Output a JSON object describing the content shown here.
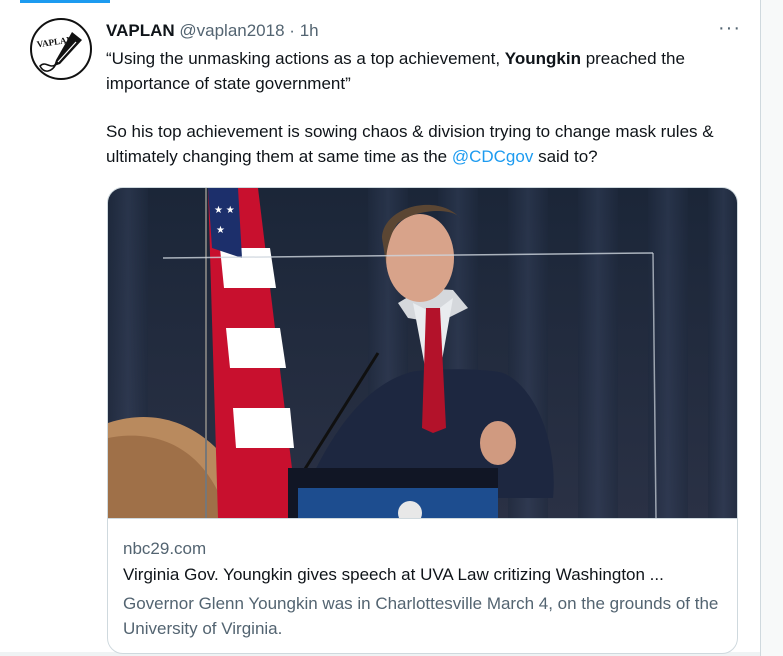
{
  "tweet": {
    "author_name": "VAPLAN",
    "handle": "@vaplan2018",
    "separator": "·",
    "time": "1h",
    "more_label": "···",
    "avatar_text": "VAPLAN",
    "line1_before": "“Using the unmasking actions as a top achievement, ",
    "line1_bold": "Youngkin",
    "line1_after": " preached the importance of state government”",
    "line2_before": "So his top achievement is sowing chaos & division trying to change mask rules & ultimately changing them at same time as the ",
    "line2_mention": "@CDCgov",
    "line2_after": " said to?"
  },
  "card": {
    "domain": "nbc29.com",
    "title": "Virginia Gov. Youngkin gives speech at UVA Law critizing Washington ...",
    "description": "Governor Glenn Youngkin was in Charlottesville March 4, on the grounds of the University of Virginia."
  },
  "colors": {
    "accent": "#1d9bf0",
    "text_primary": "#0f1419",
    "text_secondary": "#536471",
    "border": "#cfd9de"
  }
}
